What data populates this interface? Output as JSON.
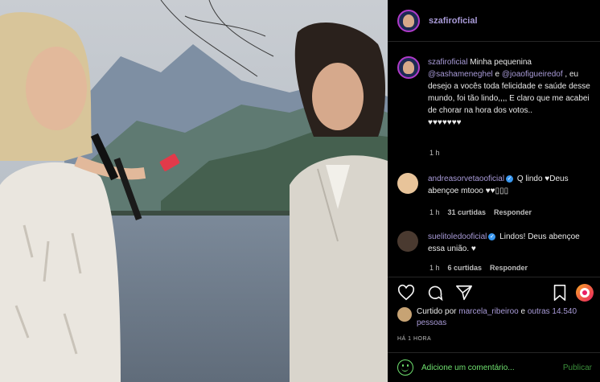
{
  "post": {
    "username": "szafiroficial",
    "caption": {
      "username": "szafiroficial",
      "part1": " Minha pequenina ",
      "mention1": "@sashameneghel",
      "part2": " e ",
      "mention2": "@joaofigueiredof",
      "part3": " , eu desejo a vocês toda felicidade e saúde desse mundo, foi tão lindo,,,, E claro que me acabei de chorar na hora dos votos..",
      "hearts": "♥♥♥♥♥♥♥",
      "time": "1 h"
    },
    "comments": [
      {
        "username": "andreasorvetaooficial",
        "text": " Q lindo ♥Deus abençoe mtooo ♥♥▯▯▯",
        "time": "1 h",
        "likes": "31 curtidas",
        "reply": "Responder",
        "avatar_color": "#e8c49a"
      },
      {
        "username": "suelitoledooficial",
        "text": " Lindos! Deus abençoe essa união. ♥",
        "time": "1 h",
        "likes": "6 curtidas",
        "reply": "Responder",
        "avatar_color": "#4a3a30"
      }
    ],
    "actions": {
      "like_icon": "heart-outline-icon",
      "comment_icon": "comment-icon",
      "share_icon": "share-icon",
      "save_icon": "bookmark-icon"
    },
    "liked_by": {
      "prefix": "Curtido por ",
      "user": "marcela_ribeiroo",
      "middle": " e ",
      "others": "outras 14.540 pessoas"
    },
    "time_ago": "HÁ 1 HORA",
    "add_comment": {
      "placeholder": "Adicione um comentário...",
      "publish": "Publicar"
    },
    "verified_glyph": "✓"
  }
}
